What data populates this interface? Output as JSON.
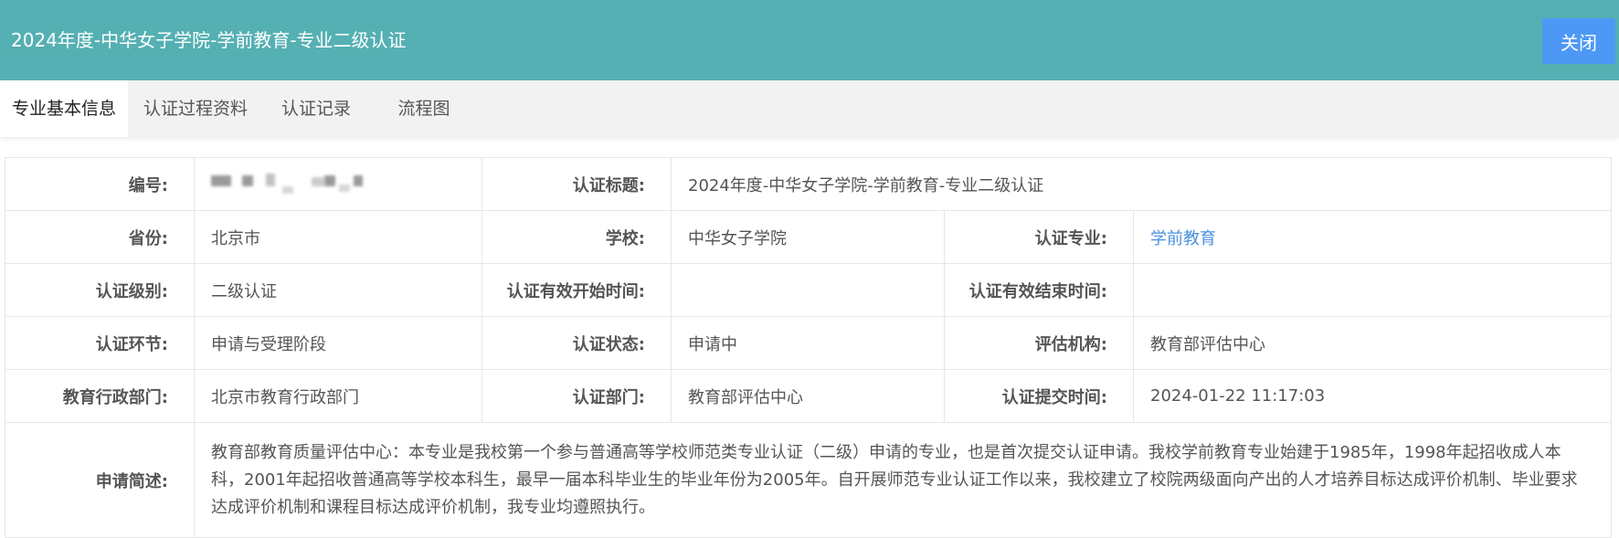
{
  "header": {
    "title": "2024年度-中华女子学院-学前教育-专业二级认证",
    "close_label": "关闭",
    "background": "#55b0b3",
    "close_color": "#4d98f5"
  },
  "tabs": [
    {
      "label": "专业基本信息",
      "active": true
    },
    {
      "label": "认证过程资料",
      "active": false
    },
    {
      "label": "认证记录",
      "active": false
    },
    {
      "label": "流程图",
      "active": false
    }
  ],
  "info": {
    "number_label": "编号:",
    "title_label": "认证标题:",
    "title_value": "2024年度-中华女子学院-学前教育-专业二级认证",
    "province_label": "省份:",
    "province_value": "北京市",
    "school_label": "学校:",
    "school_value": "中华女子学院",
    "major_label": "认证专业:",
    "major_value": "学前教育",
    "level_label": "认证级别:",
    "level_value": "二级认证",
    "start_label": "认证有效开始时间:",
    "start_value": "",
    "end_label": "认证有效结束时间:",
    "end_value": "",
    "stage_label": "认证环节:",
    "stage_value": "申请与受理阶段",
    "status_label": "认证状态:",
    "status_value": "申请中",
    "agency_label": "评估机构:",
    "agency_value": "教育部评估中心",
    "admin_label": "教育行政部门:",
    "admin_value": "北京市教育行政部门",
    "dept_label": "认证部门:",
    "dept_value": "教育部评估中心",
    "submit_label": "认证提交时间:",
    "submit_value": "2024-01-22 11:17:03",
    "desc_label": "申请简述:",
    "desc_value": "教育部教育质量评估中心：本专业是我校第一个参与普通高等学校师范类专业认证（二级）申请的专业，也是首次提交认证申请。我校学前教育专业始建于1985年，1998年起招收成人本科，2001年起招收普通高等学校本科生，最早一届本科毕业生的毕业年份为2005年。自开展师范专业认证工作以来，我校建立了校院两级面向产出的人才培养目标达成评价机制、毕业要求达成评价机制和课程目标达成评价机制，我专业均遵照执行。",
    "link_color": "#4a8fe0"
  }
}
